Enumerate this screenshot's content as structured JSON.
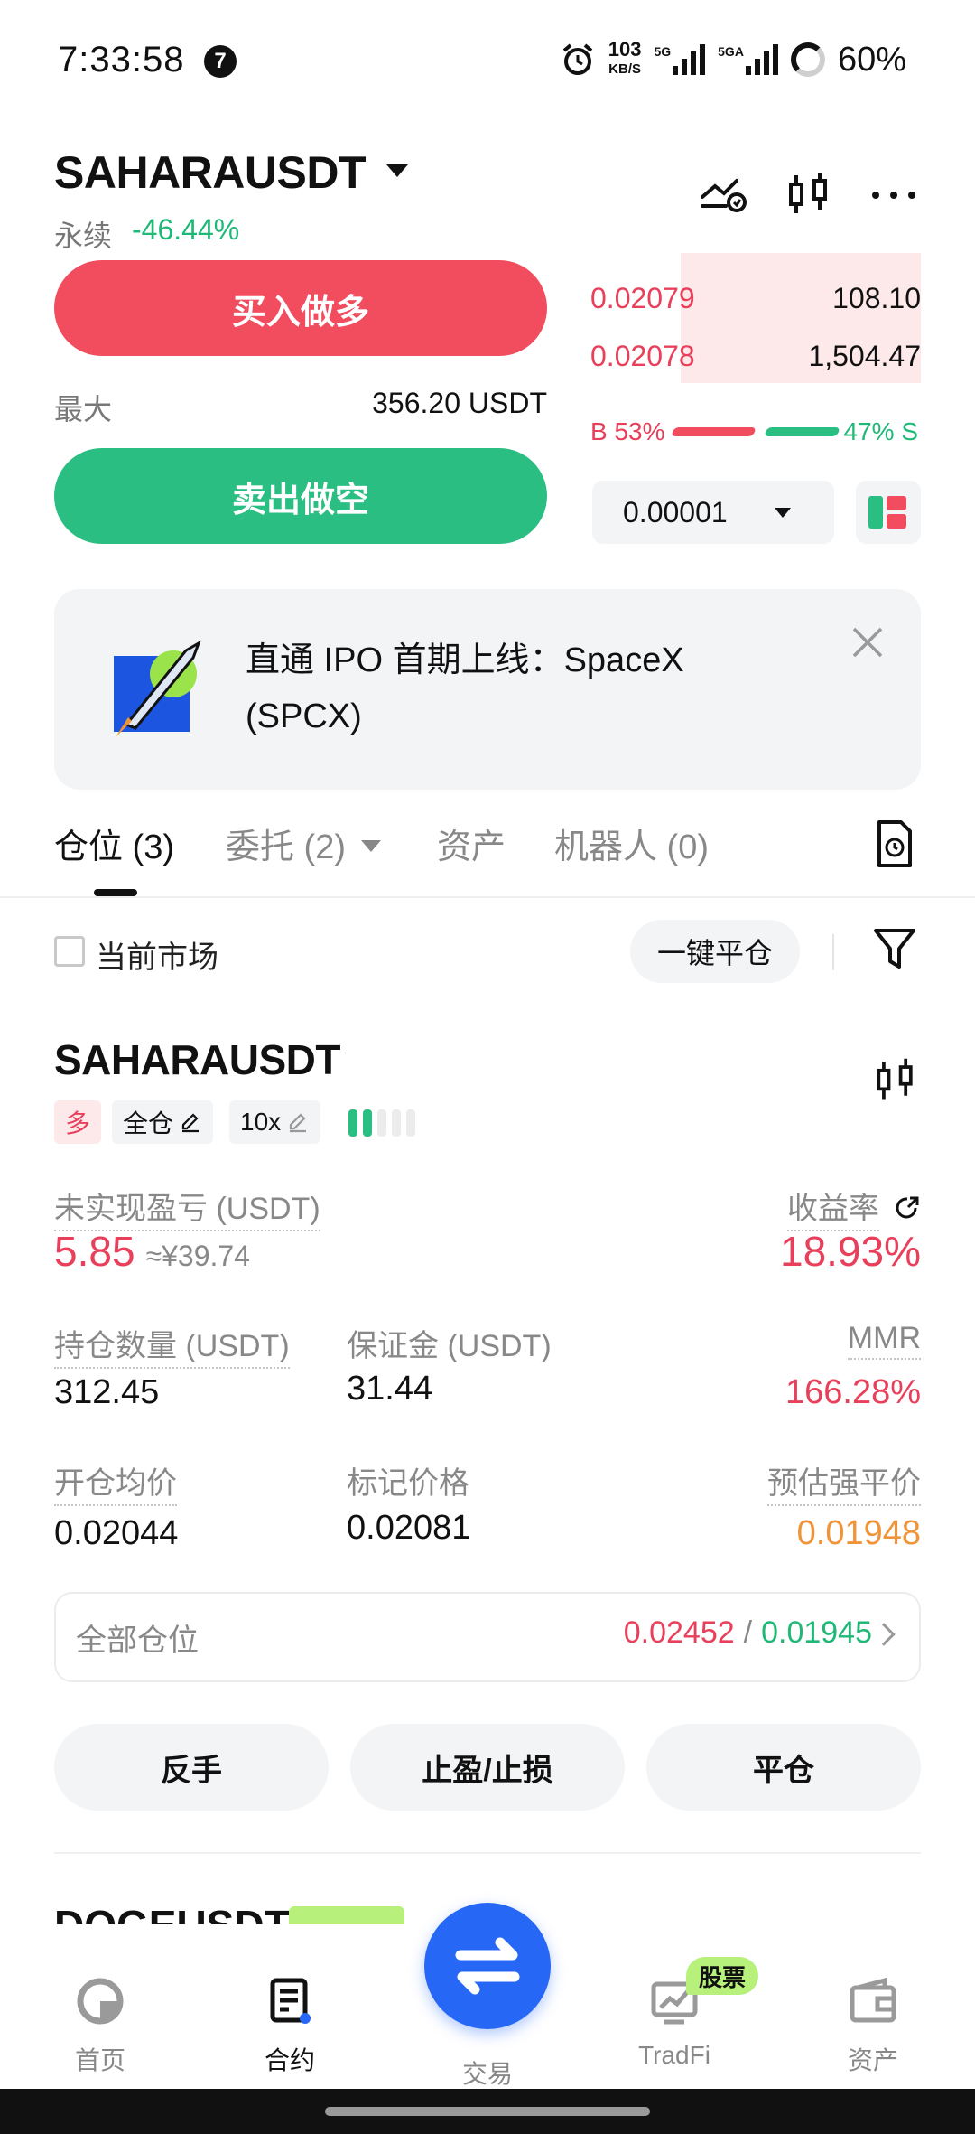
{
  "status_bar": {
    "time": "7:33:58",
    "notification_count": "7",
    "net_speed_value": "103",
    "net_speed_unit": "KB/S",
    "signal1_label": "5G",
    "signal2_label": "5GA",
    "battery": "60%"
  },
  "header": {
    "symbol": "SAHARAUSDT",
    "contract_type": "永续",
    "change": "-46.44%"
  },
  "trade": {
    "buy_label": "买入做多",
    "sell_label": "卖出做空",
    "max_label": "最大",
    "max_value": "356.20 USDT"
  },
  "order_book": {
    "asks": [
      {
        "price": "0.02079",
        "qty": "108.10"
      },
      {
        "price": "0.02078",
        "qty": "1,504.47"
      }
    ],
    "buy_ratio_label": "B 53%",
    "sell_ratio_label": "47% S",
    "buy_ratio": 0.53,
    "precision": "0.00001"
  },
  "banner": {
    "text": "直通 IPO 首期上线：SpaceX (SPCX)"
  },
  "tabs": [
    {
      "label": "仓位 (3)",
      "active": true
    },
    {
      "label": "委托 (2)",
      "active": false
    },
    {
      "label": "资产",
      "active": false
    },
    {
      "label": "机器人 (0)",
      "active": false
    }
  ],
  "filters": {
    "current_market": "当前市场",
    "close_all": "一键平仓"
  },
  "position": {
    "symbol": "SAHARAUSDT",
    "side_tag": "多",
    "margin_mode": "全仓",
    "leverage": "10x",
    "adl_level": 2,
    "unrealized_pnl_label": "未实现盈亏 (USDT)",
    "unrealized_pnl": "5.85",
    "unrealized_pnl_cny": "≈¥39.74",
    "roe_label": "收益率",
    "roe": "18.93%",
    "size_label": "持仓数量 (USDT)",
    "size": "312.45",
    "margin_label": "保证金 (USDT)",
    "margin": "31.44",
    "mmr_label": "MMR",
    "mmr": "166.28%",
    "entry_label": "开仓均价",
    "entry": "0.02044",
    "mark_label": "标记价格",
    "mark": "0.02081",
    "liq_label": "预估强平价",
    "liq": "0.01948",
    "all_positions_label": "全部仓位",
    "tp_value": "0.02452",
    "separator": "/",
    "sl_value": "0.01945",
    "actions": [
      "反手",
      "止盈/止损",
      "平仓"
    ]
  },
  "next_position": {
    "symbol": "DOGEUSDT"
  },
  "bottom_nav": {
    "items": [
      {
        "label": "首页",
        "active": false
      },
      {
        "label": "合约",
        "active": true
      },
      {
        "label": "交易",
        "active": false
      },
      {
        "label": "TradFi",
        "active": false
      },
      {
        "label": "资产",
        "active": false
      }
    ],
    "stock_badge": "股票"
  },
  "colors": {
    "buy": "#f14d5f",
    "sell": "#2bbe82",
    "fab": "#2667f5",
    "badge": "#b7f07a"
  }
}
